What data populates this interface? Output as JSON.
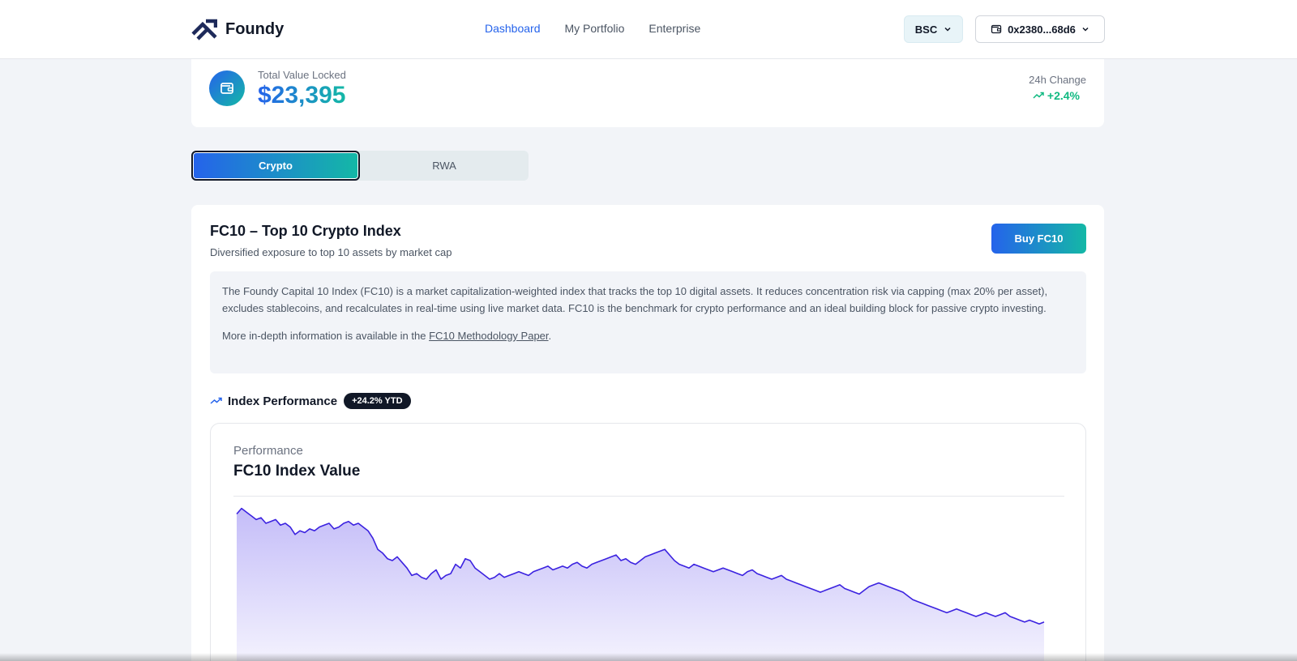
{
  "header": {
    "brand": "Foundy",
    "nav": [
      {
        "label": "Dashboard",
        "active": true
      },
      {
        "label": "My Portfolio",
        "active": false
      },
      {
        "label": "Enterprise",
        "active": false
      }
    ],
    "chain_label": "BSC",
    "wallet_label": "0x2380...68d6"
  },
  "tvl": {
    "label": "Total Value Locked",
    "value": "$23,395",
    "change_label": "24h Change",
    "change_value": "+2.4%"
  },
  "tabs": [
    {
      "label": "Crypto",
      "selected": true
    },
    {
      "label": "RWA",
      "selected": false
    }
  ],
  "index": {
    "title": "FC10 – Top 10 Crypto Index",
    "subtitle": "Diversified exposure to top 10 assets by market cap",
    "buy_label": "Buy FC10",
    "description": "The Foundy Capital 10 Index (FC10) is a market capitalization-weighted index that tracks the top 10 digital assets. It reduces concentration risk via capping (max 20% per asset), excludes stablecoins, and recalculates in real-time using live market data. FC10 is the benchmark for crypto performance and an ideal building block for passive crypto investing.",
    "more_info_prefix": "More in-depth information is available in the ",
    "more_info_link": "FC10 Methodology Paper",
    "more_info_suffix": ".",
    "performance_label": "Index Performance",
    "ytd_badge": "+24.2% YTD"
  },
  "chart": {
    "eyebrow": "Performance",
    "title": "FC10 Index Value"
  },
  "chart_data": {
    "type": "area",
    "series": [
      {
        "values": [
          95,
          98,
          96,
          94,
          92,
          93,
          90,
          91,
          92,
          89,
          90,
          88,
          84,
          86,
          85,
          87,
          86,
          88,
          89,
          90,
          87,
          88,
          90,
          91,
          89,
          90,
          88,
          86,
          82,
          76,
          74,
          71,
          70,
          72,
          69,
          66,
          62,
          63,
          61,
          60,
          63,
          65,
          60,
          62,
          63,
          68,
          66,
          71,
          70,
          66,
          64,
          62,
          60,
          61,
          63,
          61,
          62,
          63,
          64,
          63,
          62,
          64,
          65,
          66,
          67,
          65,
          66,
          67,
          66,
          68,
          69,
          67,
          66,
          68,
          69,
          70,
          71,
          72,
          73,
          70,
          71,
          69,
          68,
          70,
          72,
          73,
          74,
          75,
          76,
          73,
          70,
          68,
          67,
          66,
          68,
          67,
          66,
          65,
          64,
          65,
          66,
          65,
          64,
          63,
          62,
          64,
          65,
          63,
          62,
          61,
          60,
          61,
          62,
          60,
          59,
          58,
          57,
          56,
          55,
          54,
          53,
          54,
          55,
          56,
          57,
          55,
          54,
          53,
          52,
          54,
          56,
          57,
          58,
          57,
          56,
          55,
          54,
          53,
          51,
          49,
          48,
          47,
          46,
          45,
          44,
          43,
          42,
          43,
          44,
          43,
          42,
          41,
          40,
          41,
          42,
          41,
          40,
          41,
          42,
          40,
          39,
          38,
          37,
          38,
          37,
          36,
          37
        ]
      }
    ],
    "grid": false,
    "legend": false
  }
}
